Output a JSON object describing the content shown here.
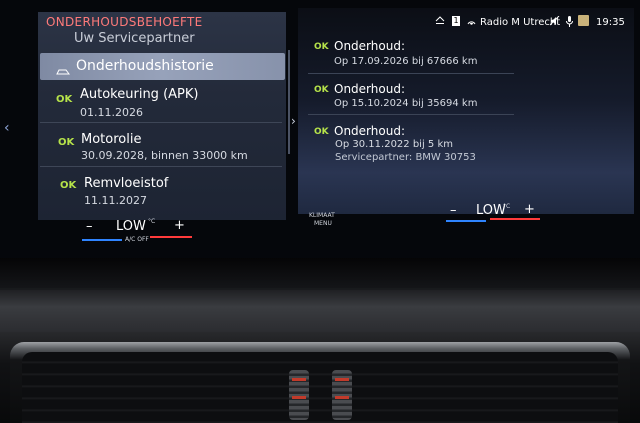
{
  "left_panel": {
    "title": "ONDERHOUDSBEHOEFTE",
    "partner": "Uw Servicepartner",
    "history": "Onderhoudshistorie",
    "items": [
      {
        "ok": "OK",
        "title": "Autokeuring (APK)",
        "date": "01.11.2026"
      },
      {
        "ok": "OK",
        "title": "Motorolie",
        "date": "30.09.2028, binnen 33000 km"
      },
      {
        "ok": "OK",
        "title": "Remvloeistof",
        "date": "11.11.2027"
      }
    ]
  },
  "status_bar": {
    "radio": "Radio M Utrecht",
    "time": "19:35",
    "badge": "1"
  },
  "right_panel": {
    "entries": [
      {
        "ok": "OK",
        "title": "Onderhoud:",
        "line1": "Op 17.09.2026 bij 67666 km",
        "line2": ""
      },
      {
        "ok": "OK",
        "title": "Onderhoud:",
        "line1": "Op 15.10.2024 bij 35694 km",
        "line2": ""
      },
      {
        "ok": "OK",
        "title": "Onderhoud:",
        "line1": "Op 30.11.2022 bij 5 km",
        "line2": "Servicepartner: BMW 30753"
      }
    ]
  },
  "climate": {
    "left": {
      "minus": "–",
      "temp": "LOW",
      "unit": "°C",
      "plus": "+",
      "ac": "A/C OFF"
    },
    "menu_line1": "KLIMAAT",
    "menu_line2": "MENU",
    "right": {
      "minus": "–",
      "temp": "LOW",
      "unit": "°C",
      "plus": "+"
    }
  },
  "colors": {
    "ok": "#b6e34a",
    "title_red": "#ff7a7a",
    "highlight": "#8f9ab2",
    "blue": "#2f84ff",
    "red": "#ff3b3b"
  }
}
